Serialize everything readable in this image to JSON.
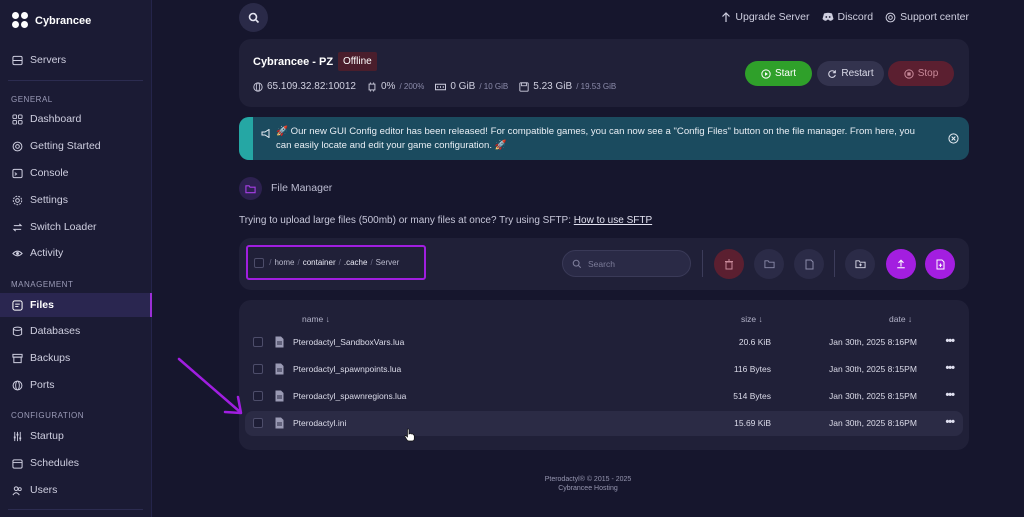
{
  "brand": {
    "name": "Cybrancee"
  },
  "sidebar": {
    "top_item": {
      "label": "Servers",
      "icon": "server-icon"
    },
    "sections": {
      "general": "GENERAL",
      "management": "MANAGEMENT",
      "configuration": "CONFIGURATION"
    },
    "general_items": [
      {
        "label": "Dashboard",
        "icon": "grid-icon"
      },
      {
        "label": "Getting Started",
        "icon": "help-icon"
      },
      {
        "label": "Console",
        "icon": "terminal-icon"
      },
      {
        "label": "Settings",
        "icon": "gear-icon"
      },
      {
        "label": "Switch Loader",
        "icon": "switch-icon"
      },
      {
        "label": "Activity",
        "icon": "eye-icon"
      }
    ],
    "management_items": [
      {
        "label": "Files",
        "icon": "folder-icon",
        "active": true
      },
      {
        "label": "Databases",
        "icon": "database-icon"
      },
      {
        "label": "Backups",
        "icon": "archive-icon"
      },
      {
        "label": "Ports",
        "icon": "network-icon"
      }
    ],
    "configuration_items": [
      {
        "label": "Startup",
        "icon": "sliders-icon"
      },
      {
        "label": "Schedules",
        "icon": "calendar-icon"
      },
      {
        "label": "Users",
        "icon": "users-icon"
      }
    ]
  },
  "topbar": {
    "upgrade": "Upgrade Server",
    "discord": "Discord",
    "support": "Support center"
  },
  "server": {
    "name": "Cybrancee - PZ",
    "status": "Offline",
    "address": "65.109.32.82:10012",
    "cpu": "0%",
    "cpu_limit": "/ 200%",
    "memory": "0 GiB",
    "memory_limit": "/ 10 GiB",
    "disk": "5.23 GiB",
    "disk_limit": "/ 19.53 GiB",
    "start_label": "Start",
    "restart_label": "Restart",
    "stop_label": "Stop"
  },
  "banner": {
    "text": "🚀 Our new GUI Config editor has been released! For compatible games, you can now see a \"Config Files\" button on the file manager. From here, you can easily locate and edit your game configuration. 🚀"
  },
  "file_manager": {
    "title": "File Manager",
    "hint": "Trying to upload large files (500mb) or many files at once? Try using SFTP:",
    "hint_link": "How to use SFTP",
    "breadcrumb": [
      "home",
      "container",
      ".cache",
      "Server"
    ],
    "search_placeholder": "Search",
    "columns": {
      "name": "name ↓",
      "size": "size ↓",
      "date": "date ↓"
    },
    "files": [
      {
        "name": "Pterodactyl_SandboxVars.lua",
        "size": "20.6 KiB",
        "date": "Jan 30th, 2025 8:16PM"
      },
      {
        "name": "Pterodactyl_spawnpoints.lua",
        "size": "116 Bytes",
        "date": "Jan 30th, 2025 8:15PM"
      },
      {
        "name": "Pterodactyl_spawnregions.lua",
        "size": "514 Bytes",
        "date": "Jan 30th, 2025 8:15PM"
      },
      {
        "name": "Pterodactyl.ini",
        "size": "15.69 KiB",
        "date": "Jan 30th, 2025 8:16PM"
      }
    ],
    "row_menu": "•••"
  },
  "footer": {
    "line1": "Pterodactyl® © 2015 - 2025",
    "line2": "Cybrancee Hosting"
  },
  "colors": {
    "accent": "#9b2fd6",
    "start": "#2fa02a",
    "stop": "#5b1f30",
    "banner": "#1b4b5f",
    "banner_accent": "#25a7a4"
  }
}
